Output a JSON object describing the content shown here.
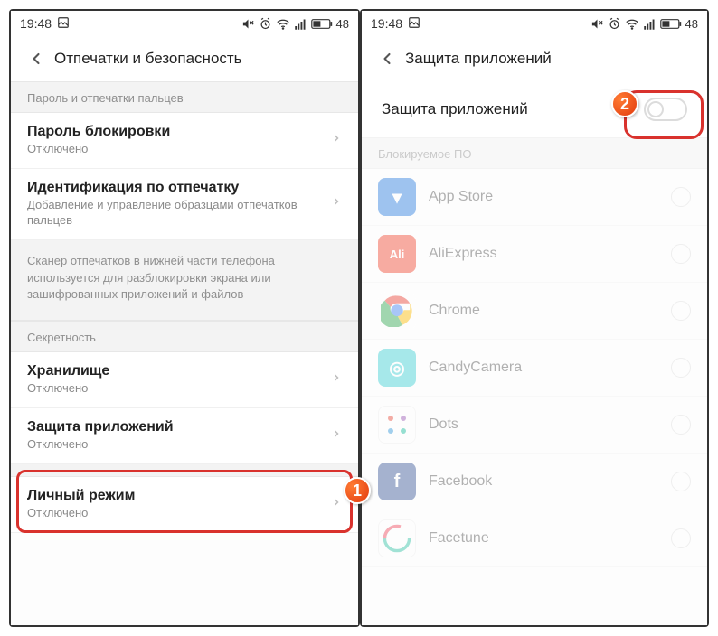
{
  "status": {
    "time": "19:48",
    "battery": "48"
  },
  "screen1": {
    "title": "Отпечатки и безопасность",
    "section1": "Пароль и отпечатки пальцев",
    "item_password": {
      "title": "Пароль блокировки",
      "sub": "Отключено"
    },
    "item_fingerprint": {
      "title": "Идентификация по отпечатку",
      "sub": "Добавление и управление образцами отпечатков пальцев"
    },
    "info": "Сканер отпечатков в нижней части телефона используется для разблокировки экрана или зашифрованных приложений и файлов",
    "section2": "Секретность",
    "item_storage": {
      "title": "Хранилище",
      "sub": "Отключено"
    },
    "item_appprotect": {
      "title": "Защита приложений",
      "sub": "Отключено"
    },
    "item_personal": {
      "title": "Личный режим",
      "sub": "Отключено"
    }
  },
  "screen2": {
    "title": "Защита приложений",
    "toggle_label": "Защита приложений",
    "section": "Блокируемое ПО",
    "apps": [
      {
        "name": "App Store",
        "icon_bg": "#2c7fe0",
        "icon_glyph": "▾"
      },
      {
        "name": "AliExpress",
        "icon_bg": "#f04a32",
        "icon_glyph": "Ali"
      },
      {
        "name": "Chrome",
        "icon_bg": "#ffffff",
        "icon_glyph": "chrome"
      },
      {
        "name": "CandyCamera",
        "icon_bg": "#3fcfd4",
        "icon_glyph": "◎"
      },
      {
        "name": "Dots",
        "icon_bg": "#ffffff",
        "icon_glyph": "dots"
      },
      {
        "name": "Facebook",
        "icon_bg": "#3b5998",
        "icon_glyph": "f"
      },
      {
        "name": "Facetune",
        "icon_bg": "#ffffff",
        "icon_glyph": "ft"
      }
    ]
  },
  "badges": {
    "b1": "1",
    "b2": "2"
  }
}
